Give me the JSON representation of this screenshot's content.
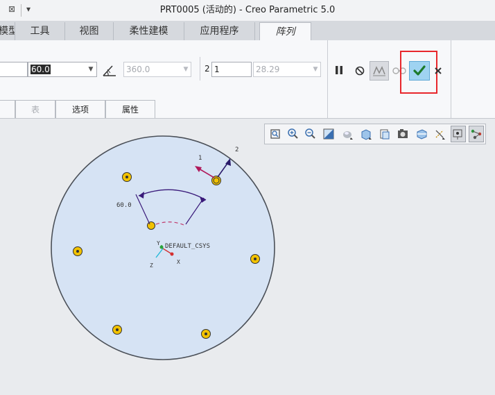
{
  "window": {
    "title": "PRT0005 (活动的) - Creo Parametric 5.0",
    "close_glyph": "⊠",
    "menu_glyph": "▾"
  },
  "ribbon_tabs": [
    {
      "label": "模型"
    },
    {
      "label": "工具"
    },
    {
      "label": "视图"
    },
    {
      "label": "柔性建模"
    },
    {
      "label": "应用程序"
    },
    {
      "label": "阵列"
    }
  ],
  "dashboard": {
    "first_value_partial": "",
    "angle_value": "60.0",
    "total_angle": "360.0",
    "count_prefix": "2",
    "count_value": "1",
    "spacing_value": "28.29"
  },
  "subtabs": [
    {
      "label": "表"
    },
    {
      "label": "选项"
    },
    {
      "label": "属性"
    }
  ],
  "actions": {
    "pause": "pause-icon",
    "no_preview": "no-preview-icon",
    "verify": "verify-icon",
    "glasses": "glasses-icon",
    "ok": "check-icon",
    "cancel": "cancel-icon"
  },
  "view_toolbar": [
    "refit-icon",
    "zoom-in-icon",
    "zoom-out-icon",
    "repaint-icon",
    "display-style-icon",
    "saved-orientations-icon",
    "view-manager-icon",
    "perspective-icon",
    "section-icon",
    "datum-display-icon",
    "spin-center-icon",
    "annotation-display-icon"
  ],
  "canvas": {
    "dimension_label": "60.0",
    "csys_label": "DEFAULT_CSYS",
    "axis_x": "X",
    "axis_y": "Y",
    "axis_z": "Z",
    "direction_1": "1",
    "direction_2": "2",
    "disk_color": "#d6e3f4",
    "pattern_member_color": "#f2c200"
  }
}
